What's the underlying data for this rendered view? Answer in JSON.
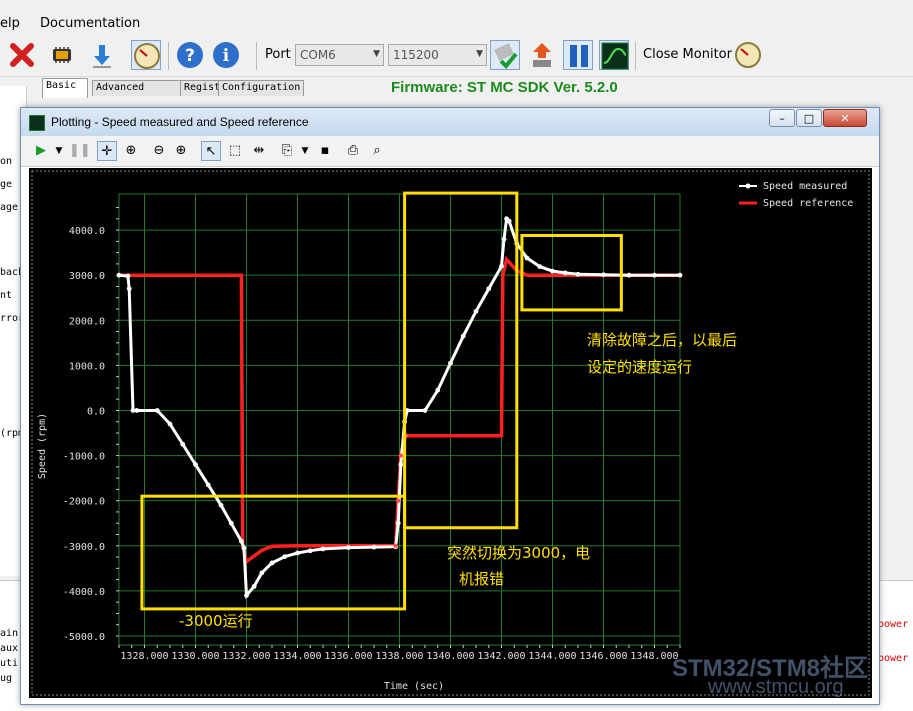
{
  "menu": {
    "help": "elp",
    "documentation": "Documentation"
  },
  "toolbar": {
    "port_label": "Port",
    "port_value": "COM6",
    "baud_value": "115200",
    "close_monitor": "Close Monitor",
    "icons": [
      "close-icon",
      "chip-icon",
      "download-icon",
      "gauge-icon",
      "help-icon",
      "info-icon",
      "connect-icon",
      "upload-icon",
      "pause-icon",
      "scope-icon",
      "gauge-icon"
    ]
  },
  "tabs": [
    "Basic",
    "Advanced",
    "Registers",
    "Configuration"
  ],
  "firmware": "Firmware: ST MC SDK Ver. 5.2.0",
  "left_labels": [
    "on",
    "ge",
    "age",
    "back",
    "nt",
    "rror",
    "(rpm"
  ],
  "bottom_labels": [
    "ain",
    "aux",
    "uti",
    "ug"
  ],
  "bottom_power": [
    "power",
    "power"
  ],
  "plot_window": {
    "title": "Plotting - Speed measured and Speed reference",
    "win_buttons": [
      "–",
      "□",
      "✕"
    ]
  },
  "chart_data": {
    "type": "line",
    "xlabel": "Time (sec)",
    "ylabel": "Speed (rpm)",
    "xlim": [
      1327.0,
      1349.0
    ],
    "ylim": [
      -5200,
      4800
    ],
    "xticks": [
      1328,
      1330,
      1332,
      1334,
      1336,
      1338,
      1340,
      1342,
      1344,
      1346,
      1348
    ],
    "xtick_labels": [
      "1328.000",
      "1330.000",
      "1332.000",
      "1334.000",
      "1336.000",
      "1338.000",
      "1340.000",
      "1342.000",
      "1344.000",
      "1346.000",
      "1348.000"
    ],
    "yticks": [
      4000,
      3000,
      2000,
      1000,
      0,
      -1000,
      -2000,
      -3000,
      -4000,
      -5000
    ],
    "ytick_labels": [
      "4000.0",
      "3000.0",
      "2000.0",
      "1000.0",
      "0.0",
      "-1000.0",
      "-2000.0",
      "-3000.0",
      "-4000.0",
      "-5000.0"
    ],
    "grid": true,
    "legend_position": "top-right",
    "series": [
      {
        "name": "Speed measured",
        "color": "#ffffff",
        "x": [
          1327.0,
          1327.35,
          1327.4,
          1327.55,
          1327.7,
          1328.5,
          1329.0,
          1329.5,
          1330.0,
          1330.5,
          1331.0,
          1331.4,
          1331.8,
          1331.9,
          1332.0,
          1332.3,
          1332.6,
          1333.0,
          1333.5,
          1334.0,
          1334.5,
          1335.0,
          1336.0,
          1337.0,
          1337.85,
          1337.95,
          1338.05,
          1338.2,
          1338.3,
          1339.0,
          1339.5,
          1340.0,
          1340.5,
          1341.0,
          1341.5,
          1342.0,
          1342.1,
          1342.2,
          1342.3,
          1342.6,
          1343.0,
          1343.5,
          1344.0,
          1344.5,
          1345.0,
          1346.0,
          1347.0,
          1348.0,
          1349.0
        ],
        "y": [
          3000,
          2980,
          2700,
          0,
          0,
          0,
          -300,
          -750,
          -1200,
          -1650,
          -2100,
          -2500,
          -2900,
          -3050,
          -4100,
          -3900,
          -3600,
          -3380,
          -3240,
          -3160,
          -3110,
          -3070,
          -3040,
          -3030,
          -3020,
          -2500,
          -1200,
          -250,
          0,
          0,
          450,
          1050,
          1650,
          2200,
          2700,
          3200,
          3800,
          4250,
          4200,
          3700,
          3380,
          3190,
          3090,
          3050,
          3020,
          3010,
          3000,
          3000,
          3000
        ]
      },
      {
        "name": "Speed reference",
        "color": "#ff2020",
        "x": [
          1327.0,
          1331.8,
          1331.85,
          1332.0,
          1332.6,
          1333.0,
          1334.0,
          1335.0,
          1336.0,
          1337.0,
          1337.85,
          1337.95,
          1338.05,
          1338.2,
          1338.25,
          1342.0,
          1342.05,
          1342.2,
          1342.6,
          1343.0,
          1343.5,
          1344.0,
          1345.0,
          1346.0,
          1349.0
        ],
        "y": [
          3000,
          3000,
          -3000,
          -3350,
          -3100,
          -3010,
          -3000,
          -3000,
          -3000,
          -3000,
          -3000,
          -2000,
          -1000,
          -600,
          -560,
          -560,
          3000,
          3350,
          3100,
          3000,
          3000,
          3000,
          3000,
          3000,
          3000
        ]
      }
    ],
    "annotations": [
      {
        "text": "清除故障之后，以最后",
        "color": "#ffe000"
      },
      {
        "text": "设定的速度运行",
        "color": "#ffe000"
      },
      {
        "text": "突然切换为3000，电",
        "color": "#ffe000"
      },
      {
        "text": "机报错",
        "color": "#ffe000"
      },
      {
        "text": "-3000运行",
        "color": "#ffe000"
      }
    ],
    "highlight_boxes": [
      {
        "x": [
          1327.9,
          1338.2
        ],
        "y": [
          -4400,
          -1900
        ]
      },
      {
        "x": [
          1338.2,
          1342.6
        ],
        "y": [
          -2600,
          4820
        ]
      },
      {
        "x": [
          1342.8,
          1346.7
        ],
        "y": [
          2230,
          3880
        ]
      }
    ]
  },
  "watermark": {
    "line1": "STM32/STM8社区",
    "line2": "www.stmcu.org"
  }
}
